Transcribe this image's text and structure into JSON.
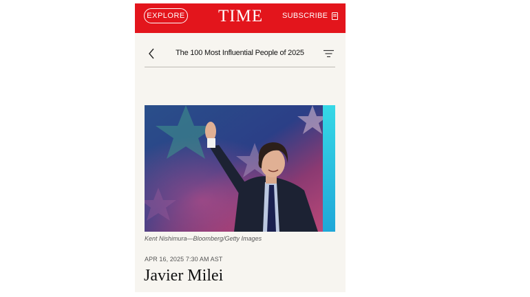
{
  "header": {
    "explore_label": "EXPLORE",
    "logo_text": "TIME",
    "subscribe_label": "SUBSCRIBE",
    "brand_color": "#e3151c"
  },
  "nav": {
    "title": "The 100 Most Influential People of 2025",
    "back_icon": "chevron-left-icon",
    "filter_icon": "filter-icon"
  },
  "article": {
    "photo_caption": "Kent Nishimura—Bloomberg/Getty Images",
    "date": "APR 16, 2025 7:30 AM AST",
    "headline": "Javier Milei"
  }
}
